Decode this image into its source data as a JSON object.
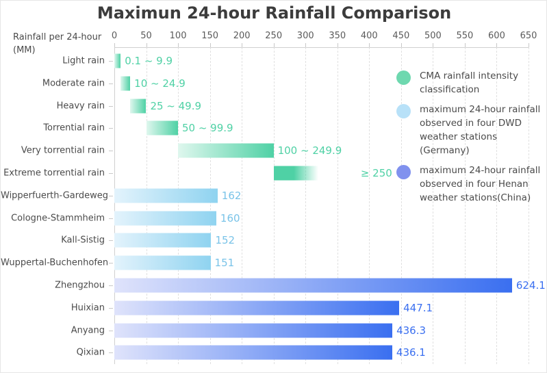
{
  "chart_data": {
    "type": "bar",
    "orientation": "horizontal",
    "title": "Maximun 24-hour Rainfall Comparison",
    "xlabel": "Rainfall per 24-hour (MM)",
    "ylabel": "",
    "xlim": [
      0,
      650
    ],
    "xticks": [
      0,
      50,
      100,
      150,
      200,
      250,
      300,
      350,
      400,
      450,
      500,
      550,
      600,
      650
    ],
    "grid": true,
    "legend_position": "right",
    "categories": [
      "Light rain",
      "Moderate rain",
      "Heavy rain",
      "Torrential rain",
      "Very torrential rain",
      "Extreme torrential rain",
      "Wipperfuerth-Gardeweg",
      "Cologne-Stammheim",
      "Kall-Sistig",
      "Wuppertal-Buchenhofen",
      "Zhengzhou",
      "Huixian",
      "Anyang",
      "Qixian"
    ],
    "series": [
      {
        "name": "CMA rainfall intensity classification",
        "type": "range",
        "color": "#5fd4aa",
        "bars": [
          {
            "category": "Light rain",
            "start": 0.1,
            "end": 9.9,
            "label": "0.1 ~ 9.9",
            "open_ended": false
          },
          {
            "category": "Moderate rain",
            "start": 10,
            "end": 24.9,
            "label": "10 ~ 24.9",
            "open_ended": false
          },
          {
            "category": "Heavy rain",
            "start": 25,
            "end": 49.9,
            "label": "25 ~ 49.9",
            "open_ended": false
          },
          {
            "category": "Torrential rain",
            "start": 50,
            "end": 99.9,
            "label": "50 ~ 99.9",
            "open_ended": false
          },
          {
            "category": "Very torrential rain",
            "start": 100,
            "end": 249.9,
            "label": "100 ~ 249.9",
            "open_ended": false
          },
          {
            "category": "Extreme torrential rain",
            "start": 250,
            "end": 320,
            "label": "≥ 250",
            "open_ended": true
          }
        ]
      },
      {
        "name": "maximum 24-hour rainfall observed in four DWD weather stations (Germany)",
        "type": "value",
        "color": "#8fd3f0",
        "bars": [
          {
            "category": "Wipperfuerth-Gardeweg",
            "start": 0,
            "end": 162,
            "label": "162",
            "open_ended": false
          },
          {
            "category": "Cologne-Stammheim",
            "start": 0,
            "end": 160,
            "label": "160",
            "open_ended": false
          },
          {
            "category": "Kall-Sistig",
            "start": 0,
            "end": 152,
            "label": "152",
            "open_ended": false
          },
          {
            "category": "Wuppertal-Buchenhofen",
            "start": 0,
            "end": 151,
            "label": "151",
            "open_ended": false
          }
        ]
      },
      {
        "name": "maximum 24-hour rainfall observed in four Henan weather stations(China)",
        "type": "value",
        "color": "#3a6ff0",
        "bars": [
          {
            "category": "Zhengzhou",
            "start": 0,
            "end": 624.1,
            "label": "624.1",
            "open_ended": false
          },
          {
            "category": "Huixian",
            "start": 0,
            "end": 447.1,
            "label": "447.1",
            "open_ended": false
          },
          {
            "category": "Anyang",
            "start": 0,
            "end": 436.3,
            "label": "436.3",
            "open_ended": false
          },
          {
            "category": "Qixian",
            "start": 0,
            "end": 436.1,
            "label": "436.1",
            "open_ended": false
          }
        ]
      }
    ]
  },
  "axis_caption": {
    "line1": "Rainfall per 24-hour",
    "line2": "(MM)"
  },
  "legend": {
    "items": [
      {
        "label": "CMA rainfall intensity classification",
        "color": "#6ed8af"
      },
      {
        "label": "maximum 24-hour rainfall observed in four DWD weather stations (Germany)",
        "color": "#b8e1f8"
      },
      {
        "label": "maximum 24-hour rainfall observed in four Henan weather stations(China)",
        "color": "#8091ee"
      }
    ]
  },
  "colors": {
    "green_light": "#dff7ee",
    "green_dark": "#4fd1a5",
    "blue_light": "#e3f3fc",
    "blue_dark": "#8fd3f0",
    "purple_light": "#dfe3fb",
    "purple_dark": "#3a6ff0",
    "green_text": "#4fd1a5",
    "blue_text": "#79c3e8",
    "purple_text": "#3a6ff0",
    "title": "#3c3c3c",
    "axis_text": "#4a4a4a"
  }
}
